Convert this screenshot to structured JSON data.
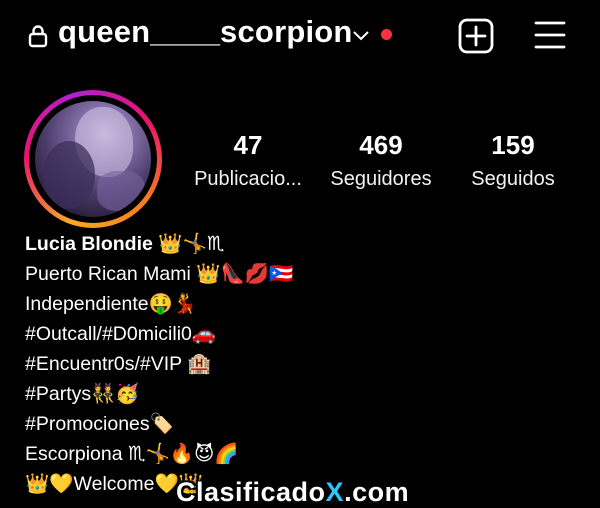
{
  "profile": {
    "username": "queen____scorpion",
    "has_unread_indicator": true,
    "indicator_color": "#ff3040"
  },
  "icons": {
    "lock": "lock-icon",
    "chevron": "chevron-down-icon",
    "add": "plus-square-icon",
    "menu": "hamburger-menu-icon"
  },
  "stats": [
    {
      "value": "47",
      "label": "Publicacio..."
    },
    {
      "value": "469",
      "label": "Seguidores"
    },
    {
      "value": "159",
      "label": "Seguidos"
    }
  ],
  "bio": {
    "name": "Lucia Blondie 👑🤸♏",
    "lines": [
      "Puerto Rican Mami 👑👠💋🇵🇷",
      "Independiente🤑💃",
      "#Outcall/#D0micili0🚗",
      "#Encuentr0s/#VIP 🏨",
      "#Partys👯🥳",
      "#Promociones🏷️",
      "Escorpiona ♏🤸🔥😈🌈",
      "👑💛Welcome💛👑"
    ]
  },
  "watermark": {
    "prefix": "Clasificado",
    "highlight": "X",
    "suffix": ".com"
  },
  "colors": {
    "background": "#000000",
    "text": "#ffffff",
    "watermark_accent": "#2ec4ff"
  }
}
